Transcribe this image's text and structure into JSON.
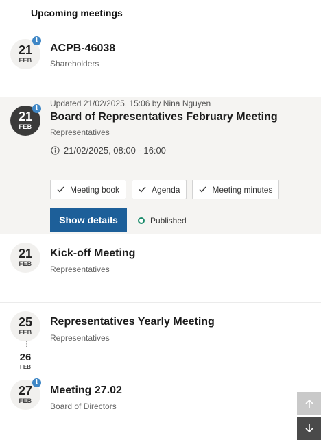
{
  "header": {
    "title": "Upcoming meetings"
  },
  "meetings": [
    {
      "day": "21",
      "month": "FEB",
      "title": "ACPB-46038",
      "group": "Shareholders",
      "info_badge": "i"
    },
    {
      "day": "21",
      "month": "FEB",
      "updated": "Updated 21/02/2025, 15:06 by Nina Nguyen",
      "title": "Board of Representatives February Meeting",
      "group": "Representatives",
      "time": "21/02/2025, 08:00 - 16:00",
      "info_badge": "i",
      "documents": [
        "Meeting book",
        "Agenda",
        "Meeting minutes"
      ],
      "details_button": "Show details",
      "status": "Published"
    },
    {
      "day": "21",
      "month": "FEB",
      "title": "Kick-off Meeting",
      "group": "Representatives"
    },
    {
      "day": "25",
      "month": "FEB",
      "end_day": "26",
      "end_month": "FEB",
      "range_separator": "⋮",
      "title": "Representatives Yearly Meeting",
      "group": "Representatives"
    },
    {
      "day": "27",
      "month": "FEB",
      "title": "Meeting 27.02",
      "group": "Board of Directors",
      "info_badge": "i"
    }
  ],
  "icons": {
    "clock": "clock-icon",
    "check": "check-icon",
    "scroll_up": "arrow-up-icon",
    "scroll_down": "arrow-down-icon",
    "info": "info-icon"
  },
  "colors": {
    "accent": "#1d5f99",
    "info_badge": "#3f87c6",
    "published": "#1a8a6a",
    "selected_background": "#f5f4f2",
    "selected_date": "#3a3a3a"
  }
}
